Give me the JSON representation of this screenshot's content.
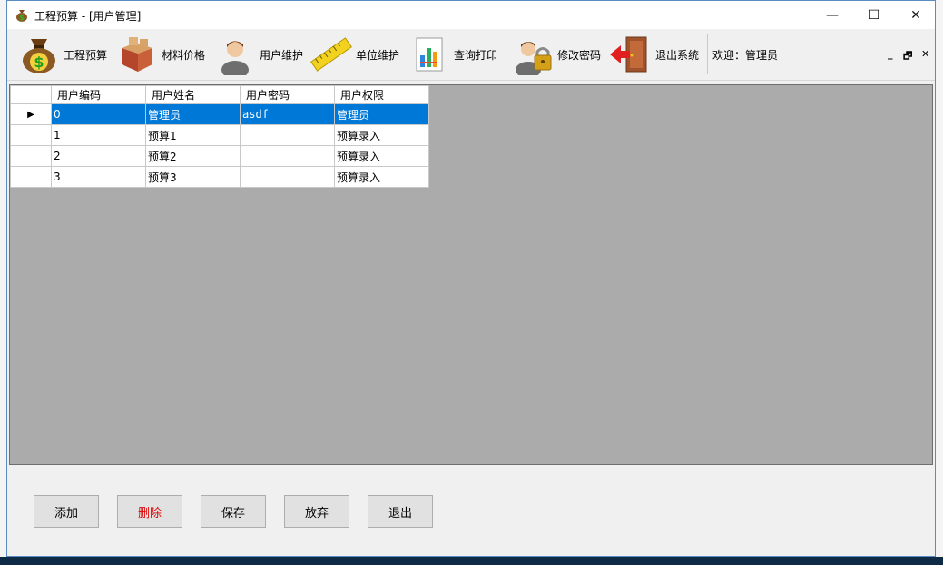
{
  "window": {
    "title": "工程预算 - [用户管理]",
    "min_glyph": "—",
    "max_glyph": "☐",
    "close_glyph": "✕"
  },
  "toolbar": {
    "items": [
      {
        "label": "工程预算",
        "icon": "money-bag-icon"
      },
      {
        "label": "材料价格",
        "icon": "boxes-icon"
      },
      {
        "label": "用户维护",
        "icon": "user-icon"
      },
      {
        "label": "单位维护",
        "icon": "ruler-icon"
      },
      {
        "label": "查询打印",
        "icon": "chart-report-icon"
      },
      {
        "label": "修改密码",
        "icon": "user-lock-icon"
      },
      {
        "label": "退出系统",
        "icon": "exit-door-icon"
      }
    ],
    "welcome": "欢迎：管理员",
    "mdi_min": "_",
    "mdi_restore": "🗗",
    "mdi_close": "✕"
  },
  "grid": {
    "columns": [
      "用户编码",
      "用户姓名",
      "用户密码",
      "用户权限"
    ],
    "rows": [
      {
        "code": "0",
        "name": "管理员",
        "password": "asdf",
        "permission": "管理员"
      },
      {
        "code": "1",
        "name": "预算1",
        "password": "",
        "permission": "预算录入"
      },
      {
        "code": "2",
        "name": "预算2",
        "password": "",
        "permission": "预算录入"
      },
      {
        "code": "3",
        "name": "预算3",
        "password": "",
        "permission": "预算录入"
      }
    ],
    "current_row_marker": "▶"
  },
  "buttons": {
    "add": "添加",
    "delete": "删除",
    "save": "保存",
    "discard": "放弃",
    "exit": "退出"
  },
  "colors": {
    "selection": "#0078d7",
    "grid_background": "#ababab",
    "delete_text": "#e00000"
  }
}
